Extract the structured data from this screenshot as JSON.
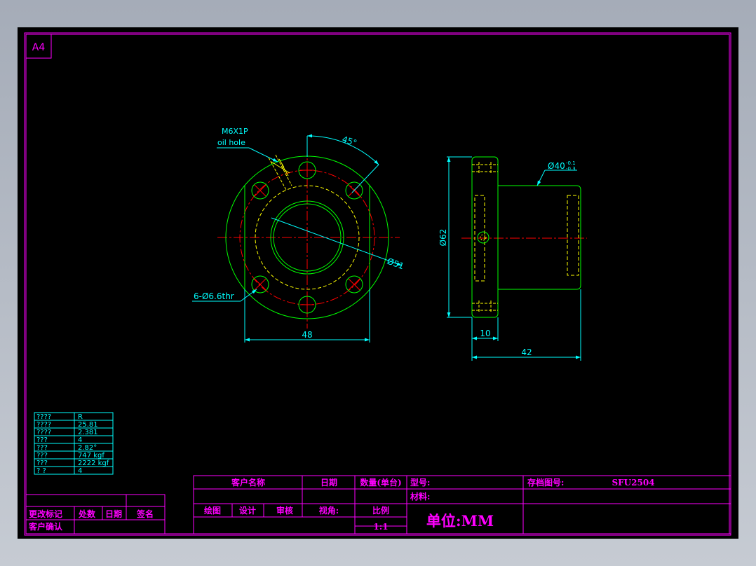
{
  "sheet": {
    "size_label": "A4",
    "border_color": "#ff00ff",
    "dimension_color": "#00ffff",
    "outline_color": "#00ff00",
    "center_line_color": "#ff0000",
    "hidden_line_color": "#ffff00",
    "background": "#000000"
  },
  "front_view": {
    "thread_label": "M6X1P",
    "oil_hole_label": "oil hole",
    "angle_label": "45°",
    "holes_label": "6-Ø6.6thr",
    "diameter_label": "Ø51",
    "width_label": "48"
  },
  "side_view": {
    "outer_diameter_label": "Ø62",
    "body_diameter_label": "Ø40",
    "tolerance_upper": "-0.1",
    "tolerance_lower": "-0.3",
    "flange_width_label": "10",
    "length_label": "42"
  },
  "spec_table": {
    "rows": [
      {
        "name": "????",
        "value": "R"
      },
      {
        "name": "????",
        "value": "25.81"
      },
      {
        "name": "????",
        "value": "2.381"
      },
      {
        "name": "???",
        "value": "4"
      },
      {
        "name": "???",
        "value": "2.82°"
      },
      {
        "name": "???",
        "value": "747 kgf"
      },
      {
        "name": "???",
        "value": "2222 kgf"
      },
      {
        "name": "?  ?",
        "value": "4"
      }
    ]
  },
  "revision_block": {
    "change_mark": "更改标记",
    "count": "处数",
    "date": "日期",
    "signature": "签名",
    "customer_confirm": "客户确认"
  },
  "title_block": {
    "customer_name": "客户名称",
    "date": "日期",
    "quantity": "数量(单台)",
    "model": "型号:",
    "archive_no_label": "存档图号:",
    "archive_no_value": "SFU2504",
    "material": "材料:",
    "drawn": "绘图",
    "designed": "设计",
    "checked": "审核",
    "view_angle": "视角:",
    "scale_label": "比例",
    "scale_value": "1:1",
    "unit": "单位:MM"
  }
}
